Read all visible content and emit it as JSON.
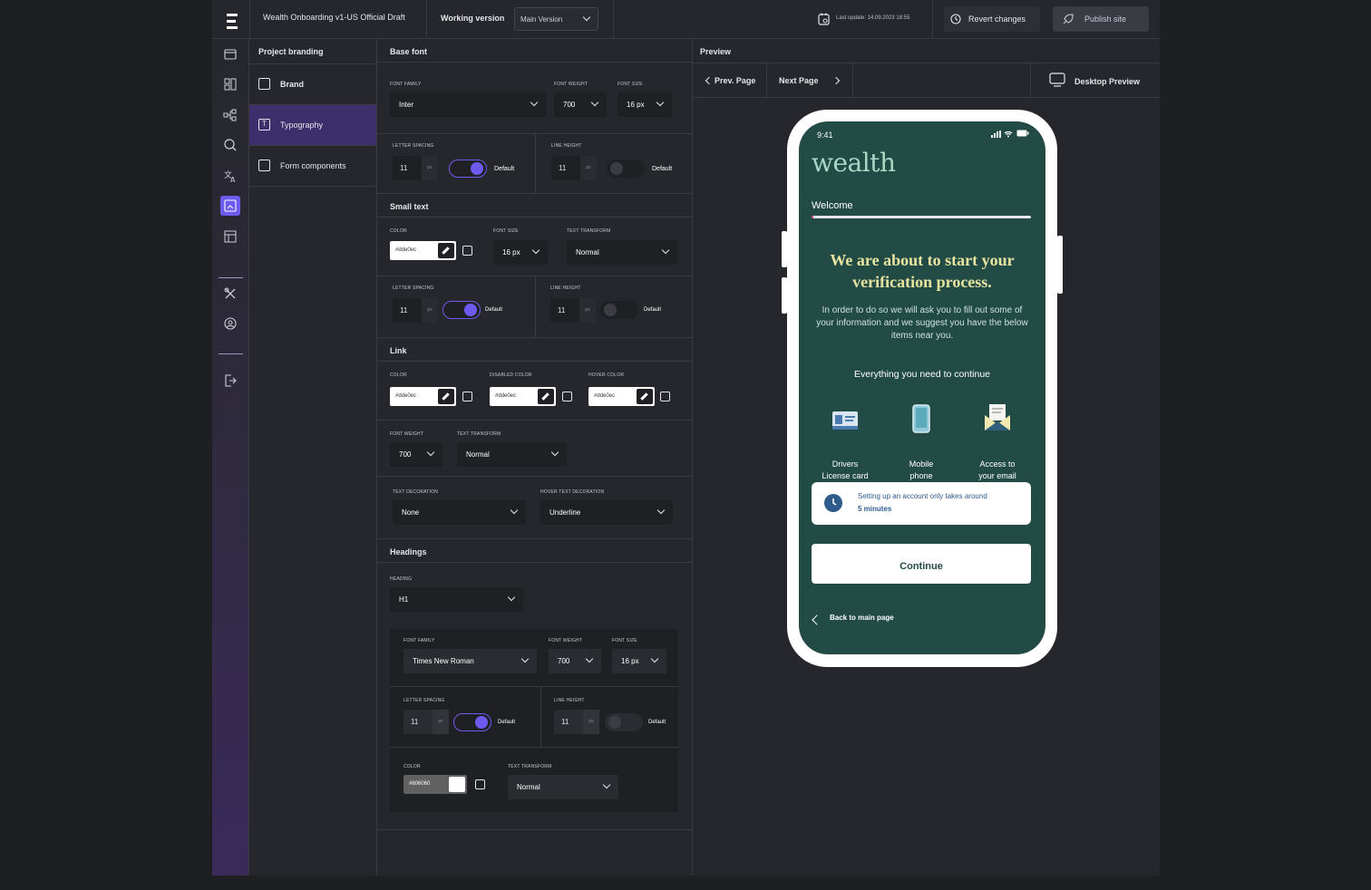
{
  "header": {
    "project_title": "Wealth Onboarding v1-US Official Draft",
    "working_version_label": "Working version",
    "version_select": "Main Version",
    "last_update": "Last update: 14.09.2023 18:55",
    "revert_label": "Revert changes",
    "publish_label": "Publish site"
  },
  "nav": {
    "title": "Project branding",
    "items": [
      {
        "label": "Brand"
      },
      {
        "label": "Typography"
      },
      {
        "label": "Form components"
      }
    ]
  },
  "base_font": {
    "title": "Base font",
    "font_family_label": "Font family",
    "font_family": "Inter",
    "font_weight_label": "Font weight",
    "font_weight": "700",
    "font_size_label": "Font size",
    "font_size": "16 px",
    "letter_spacing_label": "Letter spacing",
    "letter_spacing": "11",
    "line_height_label": "Line height",
    "line_height": "11",
    "unit": "px",
    "default_label": "Default"
  },
  "small_text": {
    "title": "Small text",
    "color_label": "Color",
    "color": "#dde0ec",
    "font_size_label": "Font size",
    "font_size": "16 px",
    "text_transform_label": "Text transform",
    "text_transform": "Normal",
    "letter_spacing_label": "Letter spacing",
    "letter_spacing": "11",
    "line_height_label": "Line height",
    "line_height": "11",
    "default_label": "Default"
  },
  "link": {
    "title": "Link",
    "color_label": "Color",
    "color": "#dde0ec",
    "disabled_color_label": "Disabled color",
    "disabled_color": "#dde0ec",
    "hover_color_label": "Hover color",
    "hover_color": "#dde0ec",
    "font_weight_label": "Font weight",
    "font_weight": "700",
    "text_transform_label": "Text transform",
    "text_transform": "Normal",
    "text_decoration_label": "Text decoration",
    "text_decoration": "None",
    "hover_text_decoration_label": "Hover text decoration",
    "hover_text_decoration": "Underline"
  },
  "headings": {
    "title": "Headings",
    "heading_label": "Heading",
    "heading": "H1",
    "font_family_label": "Font family",
    "font_family": "Times New Roman",
    "font_weight_label": "Font weight",
    "font_weight": "700",
    "font_size_label": "Font size",
    "font_size": "16 px",
    "letter_spacing_label": "Letter spacing",
    "letter_spacing": "11",
    "line_height_label": "Line height",
    "line_height": "11",
    "default_label": "Default",
    "color_label": "Color",
    "color": "#606060",
    "text_transform_label": "Text transform",
    "text_transform": "Normal"
  },
  "preview": {
    "title": "Preview",
    "prev_label": "Prev. Page",
    "next_label": "Next Page",
    "desktop_label": "Desktop Preview"
  },
  "phone": {
    "time": "9:41",
    "brand": "wealth",
    "welcome": "Welcome",
    "heading": "We are about to start your verification process.",
    "body": "In order to do so we will ask you to fill out some of your information and we suggest you have the below items near you.",
    "subheading": "Everything you need to continue",
    "features": [
      {
        "line1": "Drivers",
        "line2": "License card"
      },
      {
        "line1": "Mobile",
        "line2": "phone"
      },
      {
        "line1": "Access to",
        "line2": "your email"
      }
    ],
    "info_text": "Setting up an account only takes around",
    "info_time": "5 minutes",
    "continue_label": "Continue",
    "back_label": "Back to main page"
  },
  "colors": {
    "accent": "#6d5bf0",
    "nav_active": "#3d2f6b",
    "phone_bg": "#224b46",
    "phone_heading": "#e8e4a0"
  }
}
